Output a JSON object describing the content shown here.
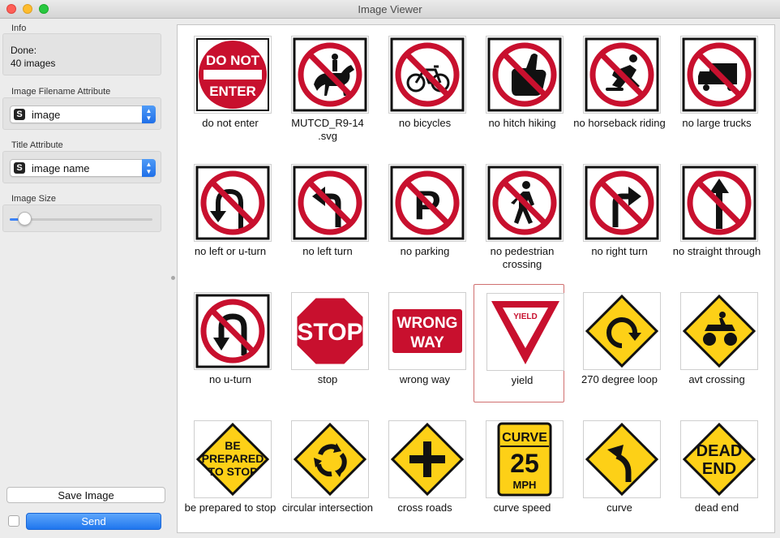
{
  "window": {
    "title": "Image Viewer"
  },
  "sidebar": {
    "info_label": "Info",
    "info_line1": "Done:",
    "info_line2": "40 images",
    "filename_label": "Image Filename Attribute",
    "filename_value": "image",
    "title_label": "Title Attribute",
    "title_value": "image name",
    "size_label": "Image Size",
    "size_fraction": 0.1,
    "save_label": "Save Image",
    "send_label": "Send",
    "send_auto_checked": false
  },
  "colors": {
    "accent": "#1f76ee",
    "selection": "#d07070",
    "sign_red": "#c8102e",
    "sign_yellow": "#fdd017"
  },
  "images": [
    {
      "label": "do not enter",
      "kind": "donotenter"
    },
    {
      "label": "MUTCD_R9-14 .svg",
      "kind": "no",
      "icon": "horse"
    },
    {
      "label": "no bicycles",
      "kind": "no",
      "icon": "bike"
    },
    {
      "label": "no hitch hiking",
      "kind": "no",
      "icon": "thumb"
    },
    {
      "label": "no horseback riding",
      "kind": "no",
      "icon": "skater"
    },
    {
      "label": "no large trucks",
      "kind": "no",
      "icon": "truck"
    },
    {
      "label": "no left or u-turn",
      "kind": "no",
      "icon": "leftu"
    },
    {
      "label": "no left turn",
      "kind": "no",
      "icon": "left"
    },
    {
      "label": "no parking",
      "kind": "no",
      "icon": "P"
    },
    {
      "label": "no pedestrian crossing",
      "kind": "no",
      "icon": "ped"
    },
    {
      "label": "no right turn",
      "kind": "no",
      "icon": "right"
    },
    {
      "label": "no straight through",
      "kind": "no",
      "icon": "straight"
    },
    {
      "label": "no u-turn",
      "kind": "no",
      "icon": "uturn"
    },
    {
      "label": "stop",
      "kind": "stop",
      "text": "STOP"
    },
    {
      "label": "wrong way",
      "kind": "wrongway",
      "text1": "WRONG",
      "text2": "WAY"
    },
    {
      "label": "yield",
      "kind": "yield",
      "text": "YIELD",
      "selected": true
    },
    {
      "label": "270 degree loop",
      "kind": "warn",
      "icon": "loop"
    },
    {
      "label": "avt crossing",
      "kind": "warn",
      "icon": "atv"
    },
    {
      "label": "be prepared to stop",
      "kind": "warntext",
      "lines": [
        "BE",
        "PREPARED",
        "TO STOP"
      ]
    },
    {
      "label": "circular intersection",
      "kind": "warn",
      "icon": "circle"
    },
    {
      "label": "cross roads",
      "kind": "warn",
      "icon": "cross"
    },
    {
      "label": "curve speed",
      "kind": "curvespeed",
      "lines": [
        "CURVE",
        "25",
        "MPH"
      ]
    },
    {
      "label": "curve",
      "kind": "warn",
      "icon": "curve"
    },
    {
      "label": "dead end",
      "kind": "warntext",
      "lines": [
        "DEAD",
        "END"
      ]
    }
  ]
}
